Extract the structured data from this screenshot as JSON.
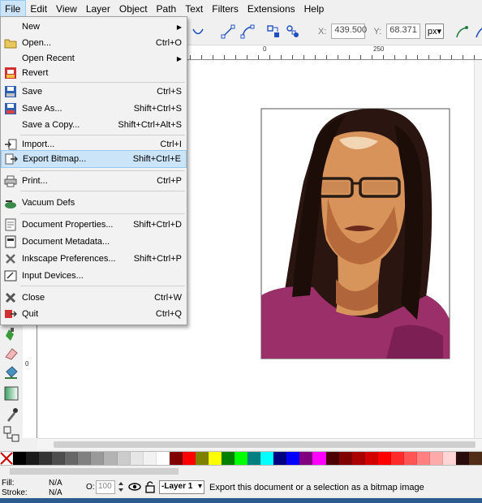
{
  "menubar": {
    "items": [
      "File",
      "Edit",
      "View",
      "Layer",
      "Object",
      "Path",
      "Text",
      "Filters",
      "Extensions",
      "Help"
    ]
  },
  "toolbar": {
    "x_label": "X:",
    "x_value": "439.500",
    "y_label": "Y:",
    "y_value": "68.371",
    "unit": "px"
  },
  "ruler": {
    "labels": [
      "0",
      "250"
    ]
  },
  "file_menu": {
    "items": [
      {
        "label": "New",
        "shortcut": "",
        "submenu": true,
        "icon": "none"
      },
      {
        "label": "Open...",
        "shortcut": "Ctrl+O",
        "icon": "folder-icon"
      },
      {
        "label": "Open Recent",
        "shortcut": "",
        "submenu": true,
        "icon": "none"
      },
      {
        "label": "Revert",
        "shortcut": "",
        "icon": "revert-icon"
      },
      {
        "label": "Save",
        "shortcut": "Ctrl+S",
        "icon": "save-icon"
      },
      {
        "label": "Save As...",
        "shortcut": "Shift+Ctrl+S",
        "icon": "save-as-icon"
      },
      {
        "label": "Save a Copy...",
        "shortcut": "Shift+Ctrl+Alt+S",
        "icon": "none"
      },
      {
        "label": "Import...",
        "shortcut": "Ctrl+I",
        "icon": "import-icon"
      },
      {
        "label": "Export Bitmap...",
        "shortcut": "Shift+Ctrl+E",
        "icon": "export-icon"
      },
      {
        "label": "Print...",
        "shortcut": "Ctrl+P",
        "icon": "printer-icon"
      },
      {
        "label": "Vacuum Defs",
        "shortcut": "",
        "icon": "vacuum-icon"
      },
      {
        "label": "Document Properties...",
        "shortcut": "Shift+Ctrl+D",
        "icon": "document-properties-icon"
      },
      {
        "label": "Document Metadata...",
        "shortcut": "",
        "icon": "document-metadata-icon"
      },
      {
        "label": "Inkscape Preferences...",
        "shortcut": "Shift+Ctrl+P",
        "icon": "preferences-icon"
      },
      {
        "label": "Input Devices...",
        "shortcut": "",
        "icon": "input-devices-icon"
      },
      {
        "label": "Close",
        "shortcut": "Ctrl+W",
        "icon": "close-icon"
      },
      {
        "label": "Quit",
        "shortcut": "Ctrl+Q",
        "icon": "quit-icon"
      }
    ]
  },
  "status": {
    "fill_label": "Fill:",
    "fill_value": "N/A",
    "stroke_label": "Stroke:",
    "stroke_value": "N/A",
    "opacity_label": "O:",
    "opacity_value": "100",
    "layer": "-Layer 1",
    "message": "Export this document or a selection as a bitmap image"
  },
  "palette_colors": [
    "#000000",
    "#1a1a1a",
    "#333333",
    "#4d4d4d",
    "#666666",
    "#808080",
    "#999999",
    "#b3b3b3",
    "#cccccc",
    "#e6e6e6",
    "#f2f2f2",
    "#ffffff",
    "#800000",
    "#ff0000",
    "#808000",
    "#ffff00",
    "#008000",
    "#00ff00",
    "#008080",
    "#00ffff",
    "#000080",
    "#0000ff",
    "#800080",
    "#ff00ff",
    "#4d0000",
    "#800000",
    "#aa0000",
    "#d40000",
    "#ff0000",
    "#ff2a2a",
    "#ff5555",
    "#ff8080",
    "#ffaaaa",
    "#ffd5d5",
    "#280b0b",
    "#502d16"
  ]
}
